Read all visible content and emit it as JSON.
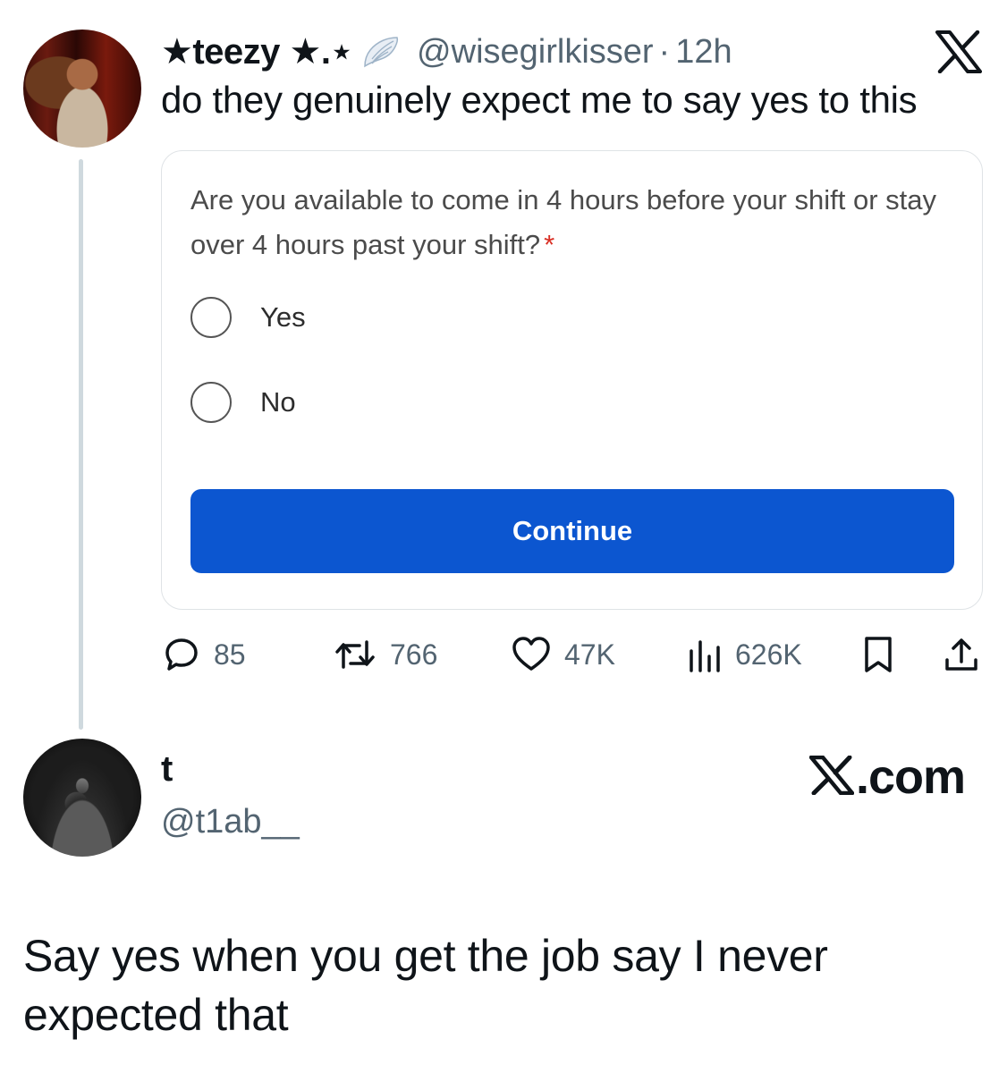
{
  "tweet": {
    "author": {
      "display_name": "★teezy ★.⋆",
      "verified_icon": "angel-wing-icon",
      "handle": "@wisegirlkisser",
      "separator": "·",
      "time": "12h"
    },
    "platform_icon": "x-logo-icon",
    "text": "do they genuinely expect me to say yes to this",
    "embedded_form": {
      "question": "Are you available to come in 4 hours before your shift or stay over 4 hours past your shift?",
      "required_marker": "*",
      "options": [
        {
          "label": "Yes",
          "selected": false
        },
        {
          "label": "No",
          "selected": false
        }
      ],
      "button_label": "Continue",
      "button_color": "#0c56d0"
    },
    "stats": {
      "replies": "85",
      "retweets": "766",
      "likes": "47K",
      "views": "626K"
    }
  },
  "reply": {
    "display_name": "t",
    "handle": "@t1ab__",
    "brand": {
      "logo_icon": "x-logo-icon",
      "suffix": ".com"
    },
    "text": "Say yes when you get the job say I never expected that"
  },
  "colors": {
    "text_primary": "#0f1419",
    "text_secondary": "#536471",
    "thread_line": "#cfd9de",
    "required": "#d93025"
  }
}
